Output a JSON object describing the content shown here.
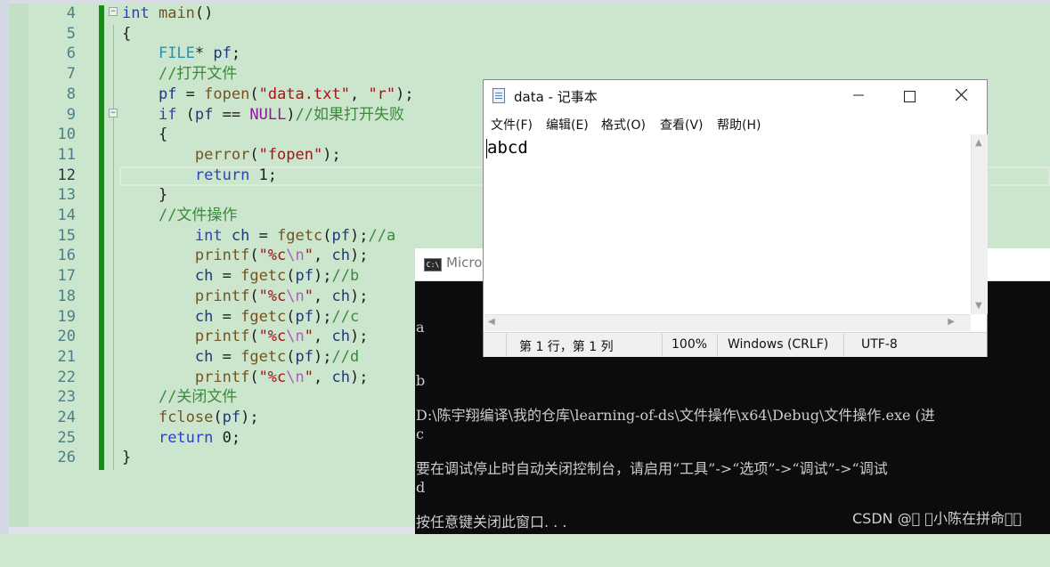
{
  "editor": {
    "current_line": "12",
    "lines": [
      {
        "no": "4",
        "code": "int main()"
      },
      {
        "no": "5",
        "code": "{"
      },
      {
        "no": "6",
        "code": "    FILE* pf;"
      },
      {
        "no": "7",
        "code": "    //打开文件"
      },
      {
        "no": "8",
        "code": "    pf = fopen(\"data.txt\", \"r\");"
      },
      {
        "no": "9",
        "code": "    if (pf == NULL)//如果打开失败"
      },
      {
        "no": "10",
        "code": "    {"
      },
      {
        "no": "11",
        "code": "        perror(\"fopen\");"
      },
      {
        "no": "12",
        "code": "        return 1;"
      },
      {
        "no": "13",
        "code": "    }"
      },
      {
        "no": "14",
        "code": "    //文件操作"
      },
      {
        "no": "15",
        "code": "        int ch = fgetc(pf);//a"
      },
      {
        "no": "16",
        "code": "        printf(\"%c\\n\", ch);"
      },
      {
        "no": "17",
        "code": "        ch = fgetc(pf);//b"
      },
      {
        "no": "18",
        "code": "        printf(\"%c\\n\", ch);"
      },
      {
        "no": "19",
        "code": "        ch = fgetc(pf);//c"
      },
      {
        "no": "20",
        "code": "        printf(\"%c\\n\", ch);"
      },
      {
        "no": "21",
        "code": "        ch = fgetc(pf);//d"
      },
      {
        "no": "22",
        "code": "        printf(\"%c\\n\", ch);"
      },
      {
        "no": "23",
        "code": "    //关闭文件"
      },
      {
        "no": "24",
        "code": "    fclose(pf);"
      },
      {
        "no": "25",
        "code": "    return 0;"
      },
      {
        "no": "26",
        "code": "}"
      }
    ]
  },
  "console": {
    "title": "Micro",
    "icon": "console-app-icon",
    "output_lines": [
      "a",
      "b",
      "c",
      "d"
    ],
    "message_lines": [
      "D:\\陈宇翔编译\\我的仓库\\learning-of-ds\\文件操作\\x64\\Debug\\文件操作.exe (进",
      "要在调试停止时自动关闭控制台，请启用“工具”->“选项”->“调试”->“调试",
      "按任意键关闭此窗口. . ."
    ]
  },
  "notepad": {
    "title": "data - 记事本",
    "icon": "notepad-icon",
    "menu": [
      "文件(F)",
      "编辑(E)",
      "格式(O)",
      "查看(V)",
      "帮助(H)"
    ],
    "content": "abcd",
    "status": {
      "position": "第 1 行，第 1 列",
      "zoom": "100%",
      "line_ending": "Windows (CRLF)",
      "encoding": "UTF-8"
    }
  },
  "watermark": "CSDN @\u0000 \u0000小陈在拼命\u0000\u0000",
  "colors": {
    "editor_bg": "#cbe6cc",
    "change_bar": "#1a8a1a",
    "console_bg": "#0c0c0c",
    "keyword": "#2a40c8",
    "comment": "#3a8a3a",
    "string": "#a31515"
  }
}
